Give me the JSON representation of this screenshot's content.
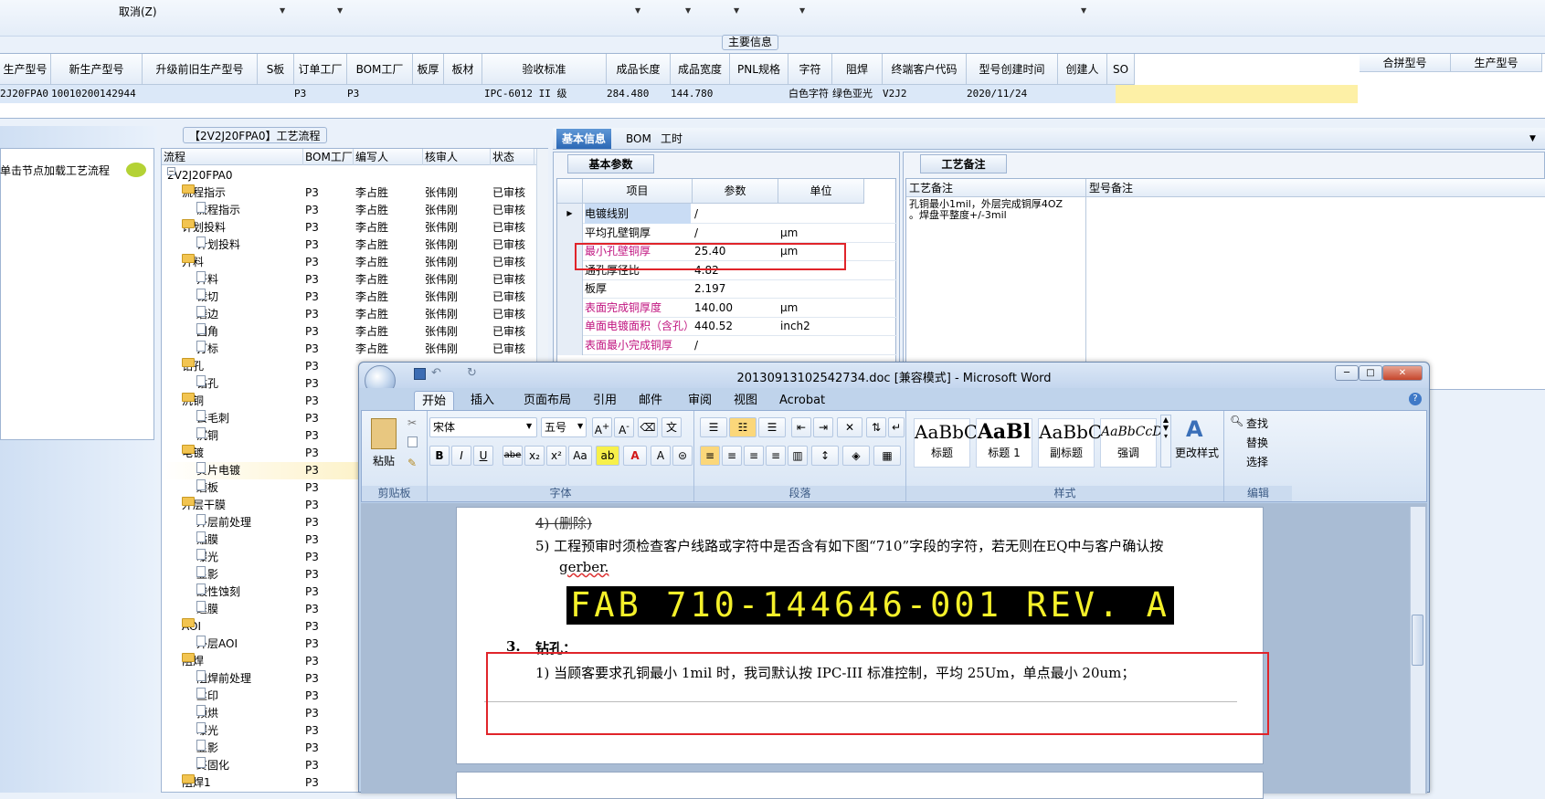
{
  "top_strip": {
    "cancel_label": "取消(Z)"
  },
  "main_info": {
    "title": "主要信息",
    "columns": [
      "生产型号",
      "新生产型号",
      "升级前旧生产型号",
      "S板",
      "订单工厂",
      "BOM工厂",
      "板厚",
      "板材",
      "验收标准",
      "成品长度",
      "成品宽度",
      "PNL规格",
      "字符",
      "阻焊",
      "终端客户代码",
      "型号创建时间",
      "创建人",
      "SO"
    ],
    "row": [
      "2J20FPA0",
      "10010200142944",
      "",
      "",
      "P3",
      "P3",
      "",
      "",
      "IPC-6012 II 级",
      "284.480",
      "144.780",
      "",
      "白色字符",
      "绿色亚光",
      "V2J2",
      "2020/11/24",
      "",
      ""
    ],
    "merge_columns": [
      "合拼型号",
      "生产型号"
    ]
  },
  "left_panel": {
    "hint": "单击节点加载工艺流程"
  },
  "process": {
    "title": "【2V2J20FPA0】工艺流程",
    "columns": [
      "流程",
      "BOM工厂",
      "编写人",
      "核审人",
      "状态"
    ],
    "rows": [
      {
        "name": "2V2J20FPA0",
        "bom": "",
        "writer": "",
        "reviewer": "",
        "status": "",
        "level": 0
      },
      {
        "name": "流程指示",
        "bom": "P3",
        "writer": "李占胜",
        "reviewer": "张伟刚",
        "status": "已审核",
        "level": 1
      },
      {
        "name": "流程指示",
        "bom": "P3",
        "writer": "李占胜",
        "reviewer": "张伟刚",
        "status": "已审核",
        "level": 2
      },
      {
        "name": "计划投料",
        "bom": "P3",
        "writer": "李占胜",
        "reviewer": "张伟刚",
        "status": "已审核",
        "level": 1
      },
      {
        "name": "计划投料",
        "bom": "P3",
        "writer": "李占胜",
        "reviewer": "张伟刚",
        "status": "已审核",
        "level": 2
      },
      {
        "name": "开料",
        "bom": "P3",
        "writer": "李占胜",
        "reviewer": "张伟刚",
        "status": "已审核",
        "level": 1
      },
      {
        "name": "开料",
        "bom": "P3",
        "writer": "李占胜",
        "reviewer": "张伟刚",
        "status": "已审核",
        "level": 2
      },
      {
        "name": "裁切",
        "bom": "P3",
        "writer": "李占胜",
        "reviewer": "张伟刚",
        "status": "已审核",
        "level": 2
      },
      {
        "name": "磨边",
        "bom": "P3",
        "writer": "李占胜",
        "reviewer": "张伟刚",
        "status": "已审核",
        "level": 2
      },
      {
        "name": "圆角",
        "bom": "P3",
        "writer": "李占胜",
        "reviewer": "张伟刚",
        "status": "已审核",
        "level": 2
      },
      {
        "name": "打标",
        "bom": "P3",
        "writer": "李占胜",
        "reviewer": "张伟刚",
        "status": "已审核",
        "level": 2
      },
      {
        "name": "钻孔",
        "bom": "P3",
        "writer": "",
        "reviewer": "",
        "status": "",
        "level": 1
      },
      {
        "name": "钻孔",
        "bom": "P3",
        "writer": "",
        "reviewer": "",
        "status": "",
        "level": 2
      },
      {
        "name": "沉铜",
        "bom": "P3",
        "writer": "",
        "reviewer": "",
        "status": "",
        "level": 1
      },
      {
        "name": "去毛刺",
        "bom": "P3",
        "writer": "",
        "reviewer": "",
        "status": "",
        "level": 2
      },
      {
        "name": "沉铜",
        "bom": "P3",
        "writer": "",
        "reviewer": "",
        "status": "",
        "level": 2
      },
      {
        "name": "电镀",
        "bom": "P3",
        "writer": "",
        "reviewer": "",
        "status": "",
        "level": 1
      },
      {
        "name": "负片电镀",
        "bom": "P3",
        "writer": "",
        "reviewer": "",
        "status": "",
        "level": 2
      },
      {
        "name": "磨板",
        "bom": "P3",
        "writer": "",
        "reviewer": "",
        "status": "",
        "level": 2
      },
      {
        "name": "外层干膜",
        "bom": "P3",
        "writer": "",
        "reviewer": "",
        "status": "",
        "level": 1
      },
      {
        "name": "外层前处理",
        "bom": "P3",
        "writer": "",
        "reviewer": "",
        "status": "",
        "level": 2
      },
      {
        "name": "贴膜",
        "bom": "P3",
        "writer": "",
        "reviewer": "",
        "status": "",
        "level": 2
      },
      {
        "name": "曝光",
        "bom": "P3",
        "writer": "",
        "reviewer": "",
        "status": "",
        "level": 2
      },
      {
        "name": "显影",
        "bom": "P3",
        "writer": "",
        "reviewer": "",
        "status": "",
        "level": 2
      },
      {
        "name": "酸性蚀刻",
        "bom": "P3",
        "writer": "",
        "reviewer": "",
        "status": "",
        "level": 2
      },
      {
        "name": "退膜",
        "bom": "P3",
        "writer": "",
        "reviewer": "",
        "status": "",
        "level": 2
      },
      {
        "name": "AOI",
        "bom": "P3",
        "writer": "",
        "reviewer": "",
        "status": "",
        "level": 1
      },
      {
        "name": "外层AOI",
        "bom": "P3",
        "writer": "",
        "reviewer": "",
        "status": "",
        "level": 2
      },
      {
        "name": "阻焊",
        "bom": "P3",
        "writer": "",
        "reviewer": "",
        "status": "",
        "level": 1
      },
      {
        "name": "阻焊前处理",
        "bom": "P3",
        "writer": "",
        "reviewer": "",
        "status": "",
        "level": 2
      },
      {
        "name": "丝印",
        "bom": "P3",
        "writer": "",
        "reviewer": "",
        "status": "",
        "level": 2
      },
      {
        "name": "预烘",
        "bom": "P3",
        "writer": "",
        "reviewer": "",
        "status": "",
        "level": 2
      },
      {
        "name": "曝光",
        "bom": "P3",
        "writer": "",
        "reviewer": "",
        "status": "",
        "level": 2
      },
      {
        "name": "显影",
        "bom": "P3",
        "writer": "",
        "reviewer": "",
        "status": "",
        "level": 2
      },
      {
        "name": "终固化",
        "bom": "P3",
        "writer": "",
        "reviewer": "",
        "status": "",
        "level": 2
      },
      {
        "name": "阻焊1",
        "bom": "P3",
        "writer": "",
        "reviewer": "",
        "status": "",
        "level": 1
      }
    ]
  },
  "tabs": {
    "basic": "基本信息",
    "bom": "BOM",
    "hours": "工时"
  },
  "basic_params": {
    "tab": "基本参数",
    "columns": [
      "项目",
      "参数",
      "单位"
    ],
    "rows": [
      {
        "item": "电镀线别",
        "value": "/",
        "unit": "",
        "highlight": false
      },
      {
        "item": "平均孔壁铜厚",
        "value": "/",
        "unit": "μm",
        "highlight": false
      },
      {
        "item": "最小孔壁铜厚",
        "value": "25.40",
        "unit": "μm",
        "highlight": true
      },
      {
        "item": "通孔厚径比",
        "value": "4.82",
        "unit": "",
        "highlight": false
      },
      {
        "item": "板厚",
        "value": "2.197",
        "unit": "",
        "highlight": false
      },
      {
        "item": "表面完成铜厚度",
        "value": "140.00",
        "unit": "μm",
        "highlight": true
      },
      {
        "item": "单面电镀面积（含孔）",
        "value": "440.52",
        "unit": "inch2",
        "highlight": true
      },
      {
        "item": "表面最小完成铜厚",
        "value": "/",
        "unit": "",
        "highlight": true
      }
    ]
  },
  "process_notes": {
    "tab": "工艺备注",
    "col1": "工艺备注",
    "col2": "型号备注",
    "note_line1": "孔铜最小1mil，外层完成铜厚4OZ",
    "note_line2": "。焊盘平整度+/-3mil"
  },
  "word": {
    "title": "20130913102542734.doc [兼容模式] - Microsoft Word",
    "tabs": [
      "开始",
      "插入",
      "页面布局",
      "引用",
      "邮件",
      "审阅",
      "视图",
      "Acrobat"
    ],
    "clipboard": {
      "paste": "粘贴",
      "group": "剪贴板"
    },
    "font": {
      "name": "宋体",
      "size": "五号",
      "group": "字体"
    },
    "paragraph": {
      "group": "段落"
    },
    "styles": {
      "group": "样式",
      "change": "更改样式",
      "items": [
        {
          "sample": "AaBbC",
          "label": "标题"
        },
        {
          "sample": "AaBl",
          "label": "标题 1"
        },
        {
          "sample": "AaBbC",
          "label": "副标题"
        },
        {
          "sample": "AaBbCcD",
          "label": "强调"
        }
      ]
    },
    "editing": {
      "group": "编辑",
      "find": "查找",
      "replace": "替换",
      "select": "选择"
    },
    "doc": {
      "line_deleted": "4) (删除)",
      "line5a": "5)  工程预审时须检查客户线路或字符中是否含有如下图“710”字段的字符，若无则在EQ中与客户确认按",
      "line5b": "gerber.",
      "fab_text": "FAB 710-144646-001 REV. A",
      "heading_num": "3.",
      "heading": "钻孔：",
      "line1": "1)  当顾客要求孔铜最小 1mil 时，我司默认按 IPC-III 标准控制，平均 25Um，单点最小 20um；"
    }
  }
}
